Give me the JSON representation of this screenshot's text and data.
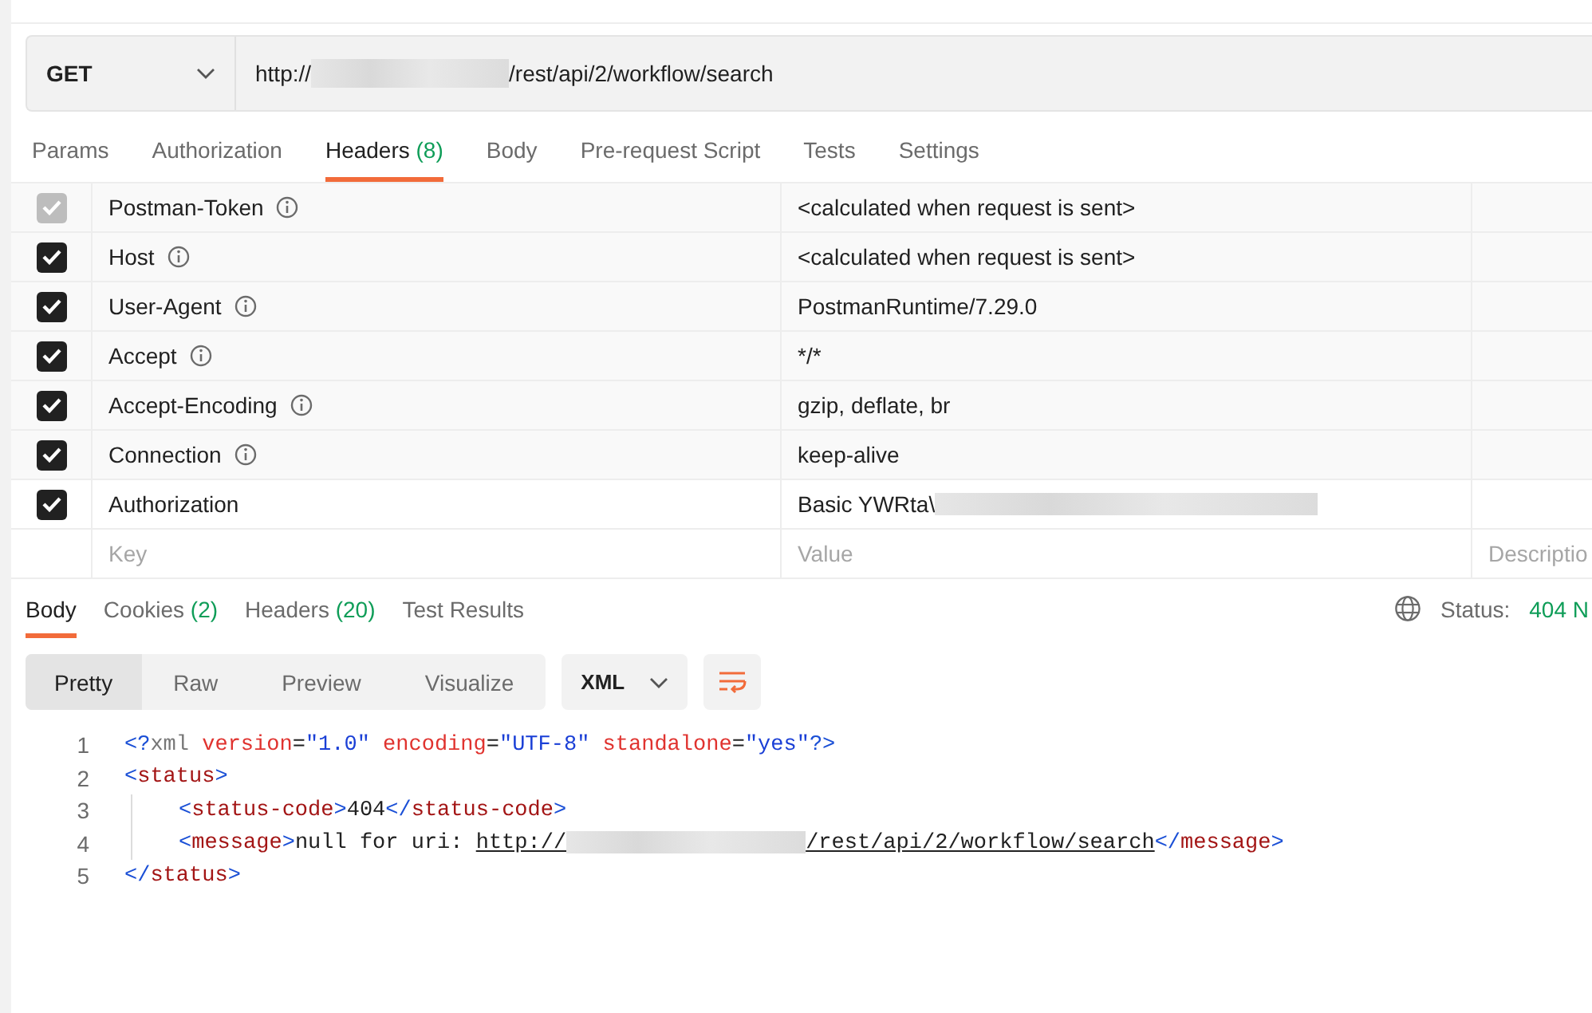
{
  "request": {
    "method": "GET",
    "url_scheme": "http://",
    "url_host_redacted": true,
    "url_path": "/rest/api/2/workflow/search"
  },
  "request_tabs": [
    {
      "label": "Params",
      "selected": false
    },
    {
      "label": "Authorization",
      "selected": false
    },
    {
      "label": "Headers",
      "count": "(8)",
      "selected": true
    },
    {
      "label": "Body",
      "selected": false
    },
    {
      "label": "Pre-request Script",
      "selected": false
    },
    {
      "label": "Tests",
      "selected": false
    },
    {
      "label": "Settings",
      "selected": false
    }
  ],
  "headers": {
    "rows": [
      {
        "key": "Postman-Token",
        "value": "<calculated when request is sent>",
        "checked": true,
        "disabled": true,
        "auto_generated": true,
        "info_icon": true,
        "value_redacted": false
      },
      {
        "key": "Host",
        "value": "<calculated when request is sent>",
        "checked": true,
        "disabled": false,
        "auto_generated": true,
        "info_icon": true,
        "value_redacted": false
      },
      {
        "key": "User-Agent",
        "value": "PostmanRuntime/7.29.0",
        "checked": true,
        "disabled": false,
        "auto_generated": true,
        "info_icon": true,
        "value_redacted": false
      },
      {
        "key": "Accept",
        "value": "*/*",
        "checked": true,
        "disabled": false,
        "auto_generated": true,
        "info_icon": true,
        "value_redacted": false
      },
      {
        "key": "Accept-Encoding",
        "value": "gzip, deflate, br",
        "checked": true,
        "disabled": false,
        "auto_generated": true,
        "info_icon": true,
        "value_redacted": false
      },
      {
        "key": "Connection",
        "value": "keep-alive",
        "checked": true,
        "disabled": false,
        "auto_generated": true,
        "info_icon": true,
        "value_redacted": false
      },
      {
        "key": "Authorization",
        "value": "Basic YWRta\\",
        "checked": true,
        "disabled": false,
        "auto_generated": false,
        "info_icon": false,
        "value_redacted": true
      }
    ],
    "new_row": {
      "key_placeholder": "Key",
      "value_placeholder": "Value",
      "description_placeholder": "Descriptio"
    }
  },
  "response_tabs": [
    {
      "label": "Body",
      "selected": true
    },
    {
      "label": "Cookies",
      "count": "(2)",
      "selected": false
    },
    {
      "label": "Headers",
      "count": "(20)",
      "selected": false
    },
    {
      "label": "Test Results",
      "selected": false
    }
  ],
  "status": {
    "label": "Status:",
    "value": "404 N"
  },
  "view_modes": [
    {
      "label": "Pretty",
      "selected": true
    },
    {
      "label": "Raw",
      "selected": false
    },
    {
      "label": "Preview",
      "selected": false
    },
    {
      "label": "Visualize",
      "selected": false
    }
  ],
  "format": {
    "label": "XML"
  },
  "wrap_lines": {
    "on": true
  },
  "code": [
    {
      "number": "1",
      "tokens": [
        {
          "kind": "bracket",
          "text": "<?"
        },
        {
          "kind": "decl",
          "text": "xml"
        },
        {
          "kind": "attr",
          "text": " version"
        },
        {
          "kind": "plain",
          "text": "="
        },
        {
          "kind": "string",
          "text": "\"1.0\""
        },
        {
          "kind": "attr",
          "text": " encoding"
        },
        {
          "kind": "plain",
          "text": "="
        },
        {
          "kind": "string",
          "text": "\"UTF-8\""
        },
        {
          "kind": "attr",
          "text": " standalone"
        },
        {
          "kind": "plain",
          "text": "="
        },
        {
          "kind": "string",
          "text": "\"yes\""
        },
        {
          "kind": "bracket",
          "text": "?>"
        }
      ]
    },
    {
      "number": "2",
      "tokens": [
        {
          "kind": "bracket",
          "text": "<"
        },
        {
          "kind": "tag",
          "text": "status"
        },
        {
          "kind": "bracket",
          "text": ">"
        }
      ],
      "children": [
        {
          "number": "3",
          "tokens": [
            {
              "kind": "bracket",
              "text": "<"
            },
            {
              "kind": "tag",
              "text": "status-code"
            },
            {
              "kind": "bracket",
              "text": ">"
            },
            {
              "kind": "plain",
              "text": "404"
            },
            {
              "kind": "bracket",
              "text": "</"
            },
            {
              "kind": "tag",
              "text": "status-code"
            },
            {
              "kind": "bracket",
              "text": ">"
            }
          ]
        },
        {
          "number": "4",
          "tokens": [
            {
              "kind": "bracket",
              "text": "<"
            },
            {
              "kind": "tag",
              "text": "message"
            },
            {
              "kind": "bracket",
              "text": ">"
            },
            {
              "kind": "plain",
              "text": "null for uri: "
            },
            {
              "kind": "link",
              "text": "http://"
            },
            {
              "kind": "redacted"
            },
            {
              "kind": "link",
              "text": "/rest/api/2/workflow/search"
            },
            {
              "kind": "bracket",
              "text": "</"
            },
            {
              "kind": "tag",
              "text": "message"
            },
            {
              "kind": "bracket",
              "text": ">"
            }
          ]
        }
      ]
    },
    {
      "number": "5",
      "tokens": [
        {
          "kind": "bracket",
          "text": "</"
        },
        {
          "kind": "tag",
          "text": "status"
        },
        {
          "kind": "bracket",
          "text": ">"
        }
      ]
    }
  ]
}
